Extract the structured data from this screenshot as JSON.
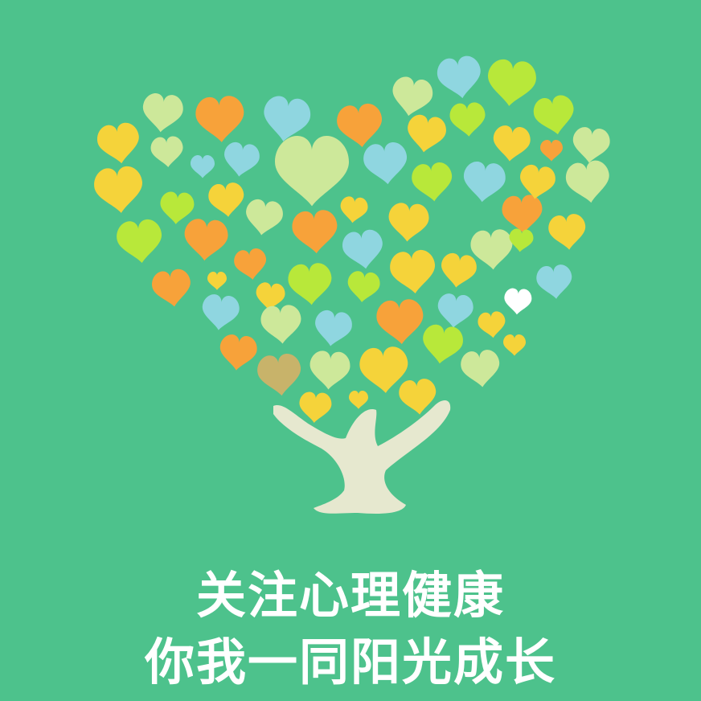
{
  "poster": {
    "background_color": "#4dc28c",
    "illustration": "heart-shaped-tree-of-hearts",
    "heart_colors": [
      "#f5d33a",
      "#f7a23a",
      "#8fd6e0",
      "#cde89a",
      "#b8e83a",
      "#ffffff",
      "#c8b36a"
    ],
    "trunk_color": "#e6e8cf",
    "slogan": {
      "line1": "关注心理健康",
      "line2": "你我一同阳光成长"
    }
  }
}
